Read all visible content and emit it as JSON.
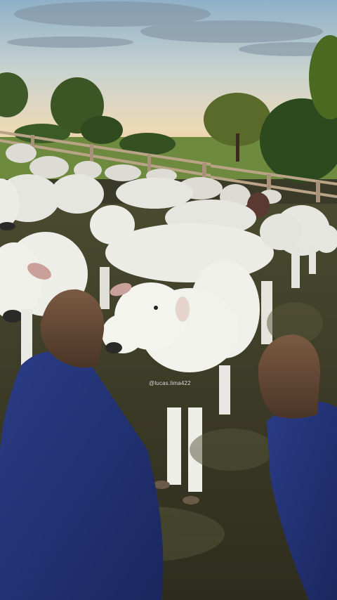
{
  "photo": {
    "subject": "herd-of-white-cattle-in-corral",
    "watermark_text": "@lucas.lima422"
  }
}
